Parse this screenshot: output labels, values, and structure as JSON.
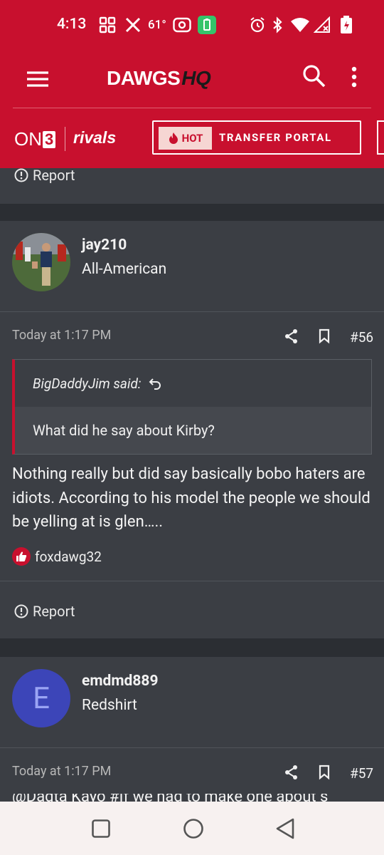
{
  "status_bar": {
    "time": "4:13",
    "temp": "61°"
  },
  "header": {
    "logo_main": "DAWGS",
    "logo_hq": "HQ"
  },
  "subnav": {
    "on3": "ON",
    "on3_num": "3",
    "rivals": "rivals",
    "hot": "HOT",
    "transfer_portal": "TRANSFER PORTAL"
  },
  "prev_post": {
    "report": "Report"
  },
  "posts": [
    {
      "username": "jay210",
      "user_title": "All-American",
      "timestamp": "Today at 1:17 PM",
      "number": "#56",
      "quote_author": "BigDaddyJim said:",
      "quote_text": "What did he say about Kirby?",
      "body": "Nothing really but did say basically bobo haters are idiots. According to his model the people we should be yelling at is glen…..",
      "reaction_user": "foxdawg32",
      "report": "Report"
    },
    {
      "username": "emdmd889",
      "user_title": "Redshirt",
      "avatar_letter": "E",
      "timestamp": "Today at 1:17 PM",
      "number": "#57",
      "body_partial": "@Dagta Kayo #If we had to make one about s"
    }
  ],
  "colors": {
    "brand_red": "#c8102e",
    "card_bg": "#3b3e44",
    "page_bg": "#2b2e33",
    "avatar_blue": "#3c45b8"
  }
}
